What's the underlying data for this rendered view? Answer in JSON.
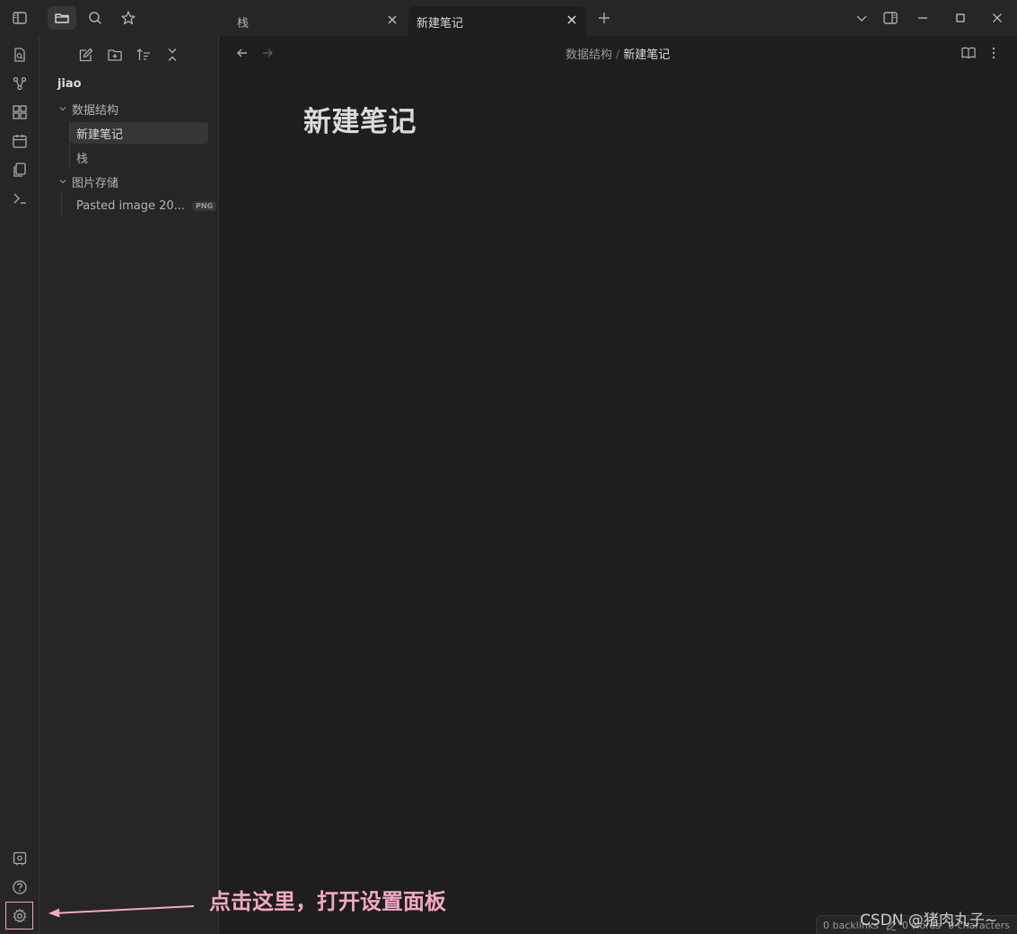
{
  "titlebar": {
    "tabs": [
      {
        "label": "栈",
        "active": false
      },
      {
        "label": "新建笔记",
        "active": true
      }
    ]
  },
  "sidebar": {
    "vault_name": "jiao",
    "tree": [
      {
        "label": "数据结构",
        "type": "folder",
        "expanded": true
      },
      {
        "label": "新建笔记",
        "type": "file",
        "selected": true
      },
      {
        "label": "栈",
        "type": "file"
      },
      {
        "label": "图片存储",
        "type": "folder",
        "expanded": true
      },
      {
        "label": "Pasted image 20...",
        "type": "file",
        "tag": "PNG"
      }
    ]
  },
  "main": {
    "breadcrumb": {
      "folder": "数据结构",
      "separator": "/",
      "current": "新建笔记"
    },
    "note_title": "新建笔记"
  },
  "annotation": {
    "text": "点击这里，打开设置面板",
    "color": "#f2a8c4"
  },
  "statusbar": {
    "backlinks": "0 backlinks",
    "words": "0 words",
    "characters": "0 characters"
  },
  "watermark": "CSDN @猪肉丸子~",
  "icons": {
    "ribbon": [
      "open-quick-switcher-icon",
      "graph-view-icon",
      "canvas-icon",
      "daily-notes-icon",
      "templates-icon",
      "command-palette-icon",
      "vault-switch-icon",
      "help-icon",
      "settings-icon"
    ],
    "titlebar": [
      "sidebar-toggle-icon",
      "folder-icon",
      "search-icon",
      "star-icon",
      "new-tab-icon",
      "tab-list-icon",
      "right-sidebar-icon",
      "minimize-icon",
      "maximize-icon",
      "close-icon"
    ]
  },
  "colors": {
    "accent_annotation": "#f2a8c4",
    "background": "#1e1e1e",
    "panel": "#262626"
  }
}
